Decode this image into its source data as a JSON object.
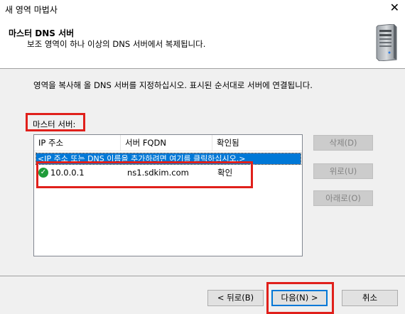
{
  "window": {
    "title": "새 영역 마법사",
    "close_glyph": "✕"
  },
  "header": {
    "title": "마스터 DNS 서버",
    "subtitle": "보조 영역이 하나 이상의 DNS 서버에서 복제됩니다."
  },
  "main": {
    "instruction": "영역을 복사해 올 DNS 서버를 지정하십시오. 표시된 순서대로 서버에 연결됩니다.",
    "masters_label": "마스터 서버:",
    "columns": [
      "IP 주소",
      "서버 FQDN",
      "확인됨"
    ],
    "add_row_text": "<IP 주소 또는 DNS 이름을 추가하려면 여기를 클릭하십시오.>",
    "rows": [
      {
        "status_icon": "check-circle-icon",
        "ip": "10.0.0.1",
        "fqdn": "ns1.sdkim.com",
        "validated": "확인"
      }
    ],
    "side_buttons": {
      "delete": "삭제(D)",
      "up": "위로(U)",
      "down": "아래로(O)"
    }
  },
  "footer": {
    "back": "< 뒤로(B)",
    "next": "다음(N) >",
    "cancel": "취소"
  },
  "colors": {
    "highlight": "#e0201b",
    "selection": "#0078d7",
    "check_green": "#1f9c3a"
  }
}
